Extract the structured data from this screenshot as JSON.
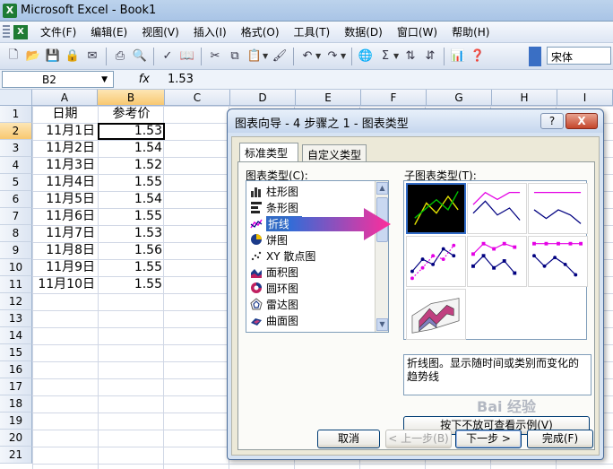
{
  "window": {
    "title": "Microsoft Excel - Book1",
    "app_icon": "X"
  },
  "menu": {
    "doc_icon": "X",
    "items": [
      "文件(F)",
      "编辑(E)",
      "视图(V)",
      "插入(I)",
      "格式(O)",
      "工具(T)",
      "数据(D)",
      "窗口(W)",
      "帮助(H)"
    ]
  },
  "toolbar": {
    "font_name": "宋体",
    "buttons": [
      "new-icon",
      "open-icon",
      "save-icon",
      "permission-icon",
      "email-icon",
      "print-icon",
      "print-preview-icon",
      "spelling-icon",
      "research-icon",
      "cut-icon",
      "copy-icon",
      "paste-icon",
      "format-painter-icon",
      "undo-icon",
      "redo-icon",
      "hyperlink-icon",
      "autosum-icon",
      "sort-ascending-icon",
      "sort-descending-icon",
      "chart-wizard-icon",
      "help-icon"
    ]
  },
  "formula_bar": {
    "name_box": "B2",
    "fx_label": "fx",
    "content": "1.53"
  },
  "sheet": {
    "columns": [
      "A",
      "B",
      "C",
      "D",
      "E",
      "F",
      "G",
      "H",
      "I"
    ],
    "selected_column": "B",
    "selected_row": 2,
    "rows": [
      1,
      2,
      3,
      4,
      5,
      6,
      7,
      8,
      9,
      10,
      11,
      12,
      13,
      14,
      15,
      16,
      17,
      18,
      19,
      20,
      21
    ],
    "header_row": {
      "A": "日期",
      "B": "参考价"
    },
    "data": [
      {
        "date": "11月1日",
        "value": "1.53"
      },
      {
        "date": "11月2日",
        "value": "1.54"
      },
      {
        "date": "11月3日",
        "value": "1.52"
      },
      {
        "date": "11月4日",
        "value": "1.55"
      },
      {
        "date": "11月5日",
        "value": "1.54"
      },
      {
        "date": "11月6日",
        "value": "1.55"
      },
      {
        "date": "11月7日",
        "value": "1.53"
      },
      {
        "date": "11月8日",
        "value": "1.56"
      },
      {
        "date": "11月9日",
        "value": "1.55"
      },
      {
        "date": "11月10日",
        "value": "1.55"
      }
    ]
  },
  "dialog": {
    "title": "图表向导 - 4 步骤之 1 - 图表类型",
    "help_label": "?",
    "close_label": "X",
    "tabs": {
      "standard": "标准类型",
      "custom": "自定义类型"
    },
    "chart_type_label": "图表类型(C):",
    "subtype_label": "子图表类型(T):",
    "chart_types": [
      {
        "label": "柱形图",
        "icon": "column-chart-icon"
      },
      {
        "label": "条形图",
        "icon": "bar-chart-icon"
      },
      {
        "label": "折线图",
        "icon": "line-chart-icon"
      },
      {
        "label": "饼图",
        "icon": "pie-chart-icon"
      },
      {
        "label": "XY 散点图",
        "icon": "scatter-chart-icon"
      },
      {
        "label": "面积图",
        "icon": "area-chart-icon"
      },
      {
        "label": "圆环图",
        "icon": "doughnut-chart-icon"
      },
      {
        "label": "雷达图",
        "icon": "radar-chart-icon"
      },
      {
        "label": "曲面图",
        "icon": "surface-chart-icon"
      }
    ],
    "selected_type": "折线图",
    "description": "折线图。显示随时间或类别而变化的趋势线",
    "preview_button": "按下不放可查看示例(V)",
    "buttons": {
      "cancel": "取消",
      "back": "< 上一步(B)",
      "next": "下一步 >",
      "finish": "完成(F)"
    },
    "colors": {
      "selection": "#316ac5",
      "line_series": "#e400e4",
      "arrow_start": "#2f6dd8",
      "arrow_end": "#ff2d9b"
    }
  },
  "watermark": "Bai 经验"
}
